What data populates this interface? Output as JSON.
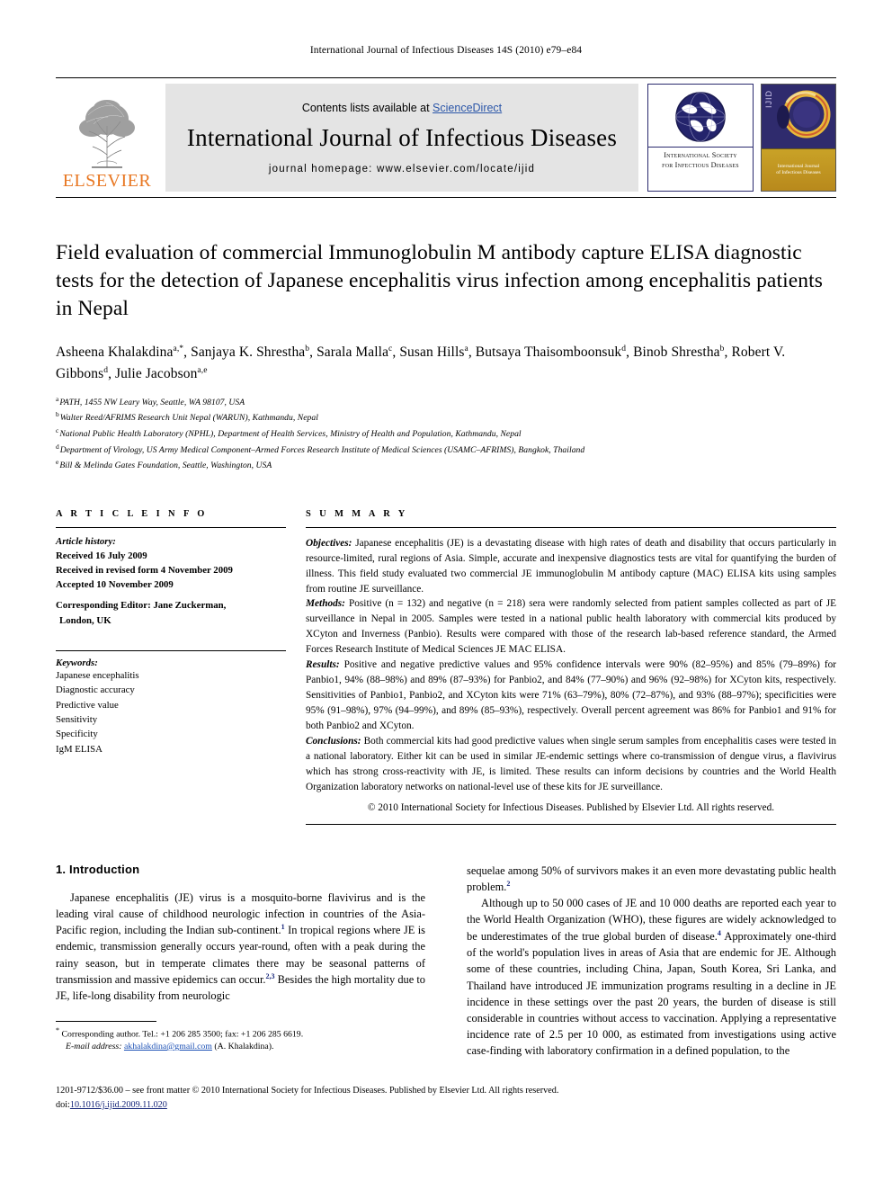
{
  "running_head": "International Journal of Infectious Diseases 14S (2010) e79–e84",
  "masthead": {
    "publisher": "ELSEVIER",
    "contents_prefix": "Contents lists available at ",
    "contents_link": "ScienceDirect",
    "journal_title": "International Journal of Infectious Diseases",
    "homepage": "journal homepage: www.elsevier.com/locate/ijid",
    "society_line1": "International Society",
    "society_line2": "for Infectious Diseases",
    "cover_spine": "IJID",
    "cover_title_line1": "International Journal",
    "cover_title_line2": "of Infectious Diseases",
    "link_color": "#2b56a8",
    "elsevier_color": "#E87722"
  },
  "article": {
    "title": "Field evaluation of commercial Immunoglobulin M antibody capture ELISA diagnostic tests for the detection of Japanese encephalitis virus infection among encephalitis patients in Nepal",
    "authors_line1": "Asheena Khalakdina a,*, Sanjaya K. Shrestha b, Sarala Malla c, Susan Hills a, Butsaya Thaisomboonsuk d,",
    "authors_line2": "Binob Shrestha b, Robert V. Gibbons d, Julie Jacobson a,e",
    "authors": [
      {
        "name": "Asheena Khalakdina",
        "sup": "a,*",
        "sep": ", "
      },
      {
        "name": "Sanjaya K. Shrestha",
        "sup": "b",
        "sep": ", "
      },
      {
        "name": "Sarala Malla",
        "sup": "c",
        "sep": ", "
      },
      {
        "name": "Susan Hills",
        "sup": "a",
        "sep": ", "
      },
      {
        "name": "Butsaya Thaisomboonsuk",
        "sup": "d",
        "sep": ", "
      },
      {
        "name": "Binob Shrestha",
        "sup": "b",
        "sep": ", "
      },
      {
        "name": "Robert V. Gibbons",
        "sup": "d",
        "sep": ", "
      },
      {
        "name": "Julie Jacobson",
        "sup": "a,e",
        "sep": ""
      }
    ],
    "affiliations": [
      {
        "mark": "a",
        "text": "PATH, 1455 NW Leary Way, Seattle, WA 98107, USA"
      },
      {
        "mark": "b",
        "text": "Walter Reed/AFRIMS Research Unit Nepal (WARUN), Kathmandu, Nepal"
      },
      {
        "mark": "c",
        "text": "National Public Health Laboratory (NPHL), Department of Health Services, Ministry of Health and Population, Kathmandu, Nepal"
      },
      {
        "mark": "d",
        "text": "Department of Virology, US Army Medical Component–Armed Forces Research Institute of Medical Sciences (USAMC–AFRIMS), Bangkok, Thailand"
      },
      {
        "mark": "e",
        "text": "Bill & Melinda Gates Foundation, Seattle, Washington, USA"
      }
    ]
  },
  "info": {
    "heading": "A R T I C L E  I N F O",
    "history_label": "Article history:",
    "history": [
      "Received 16 July 2009",
      "Received in revised form 4 November 2009",
      "Accepted 10 November 2009"
    ],
    "editor_label": "Corresponding Editor:",
    "editor_value": " Jane Zuckerman,",
    "editor_value2": "London, UK",
    "keywords_label": "Keywords:",
    "keywords": [
      "Japanese encephalitis",
      "Diagnostic accuracy",
      "Predictive value",
      "Sensitivity",
      "Specificity",
      "IgM ELISA"
    ]
  },
  "summary": {
    "heading": "S U M M A R Y",
    "objectives_label": "Objectives:",
    "objectives": " Japanese encephalitis (JE) is a devastating disease with high rates of death and disability that occurs particularly in resource-limited, rural regions of Asia. Simple, accurate and inexpensive diagnostics tests are vital for quantifying the burden of illness. This field study evaluated two commercial JE immunoglobulin M antibody capture (MAC) ELISA kits using samples from routine JE surveillance.",
    "methods_label": "Methods:",
    "methods": " Positive (n = 132) and negative (n = 218) sera were randomly selected from patient samples collected as part of JE surveillance in Nepal in 2005. Samples were tested in a national public health laboratory with commercial kits produced by XCyton and Inverness (Panbio). Results were compared with those of the research lab-based reference standard, the Armed Forces Research Institute of Medical Sciences JE MAC ELISA.",
    "results_label": "Results:",
    "results": " Positive and negative predictive values and 95% confidence intervals were 90% (82–95%) and 85% (79–89%) for Panbio1, 94% (88–98%) and 89% (87–93%) for Panbio2, and 84% (77–90%) and 96% (92–98%) for XCyton kits, respectively. Sensitivities of Panbio1, Panbio2, and XCyton kits were 71% (63–79%), 80% (72–87%), and 93% (88–97%); specificities were 95% (91–98%), 97% (94–99%), and 89% (85–93%), respectively. Overall percent agreement was 86% for Panbio1 and 91% for both Panbio2 and XCyton.",
    "conclusions_label": "Conclusions:",
    "conclusions": " Both commercial kits had good predictive values when single serum samples from encephalitis cases were tested in a national laboratory. Either kit can be used in similar JE-endemic settings where co-transmission of dengue virus, a flavivirus which has strong cross-reactivity with JE, is limited. These results can inform decisions by countries and the World Health Organization laboratory networks on national-level use of these kits for JE surveillance.",
    "copyright": "© 2010 International Society for Infectious Diseases. Published by Elsevier Ltd. All rights reserved."
  },
  "body": {
    "section_heading": "1. Introduction",
    "left_p1_a": "Japanese encephalitis (JE) virus is a mosquito-borne flavivirus and is the leading viral cause of childhood neurologic infection in countries of the Asia-Pacific region, including the Indian sub-continent.",
    "left_p1_sup1": "1",
    "left_p1_b": " In tropical regions where JE is endemic, transmission generally occurs year-round, often with a peak during the rainy season, but in temperate climates there may be seasonal patterns of transmission and massive epidemics can occur.",
    "left_p1_sup2": "2,3",
    "left_p1_c": " Besides the high mortality due to JE, life-long disability from neurologic",
    "right_p1_a": "sequelae among 50% of survivors makes it an even more devastating public health problem.",
    "right_p1_sup": "2",
    "right_p2_a": "Although up to 50 000 cases of JE and 10 000 deaths are reported each year to the World Health Organization (WHO), these figures are widely acknowledged to be underestimates of the true global burden of disease.",
    "right_p2_sup": "4",
    "right_p2_b": " Approximately one-third of the world's population lives in areas of Asia that are endemic for JE. Although some of these countries, including China, Japan, South Korea, Sri Lanka, and Thailand have introduced JE immunization programs resulting in a decline in JE incidence in these settings over the past 20 years, the burden of disease is still considerable in countries without access to vaccination. Applying a representative incidence rate of 2.5 per 10 000, as estimated from investigations using active case-finding with laboratory confirmation in a defined population, to the"
  },
  "footnote": {
    "star": "*",
    "corresponding": " Corresponding author. Tel.: +1 206 285 3500; fax: +1 206 285 6619.",
    "email_label": "E-mail address:",
    "email": "akhalakdina@gmail.com",
    "email_suffix": " (A. Khalakdina)."
  },
  "page_footer": {
    "line1": "1201-9712/$36.00 – see front matter © 2010 International Society for Infectious Diseases. Published by Elsevier Ltd. All rights reserved.",
    "doi_label": "doi:",
    "doi": "10.1016/j.ijid.2009.11.020"
  }
}
